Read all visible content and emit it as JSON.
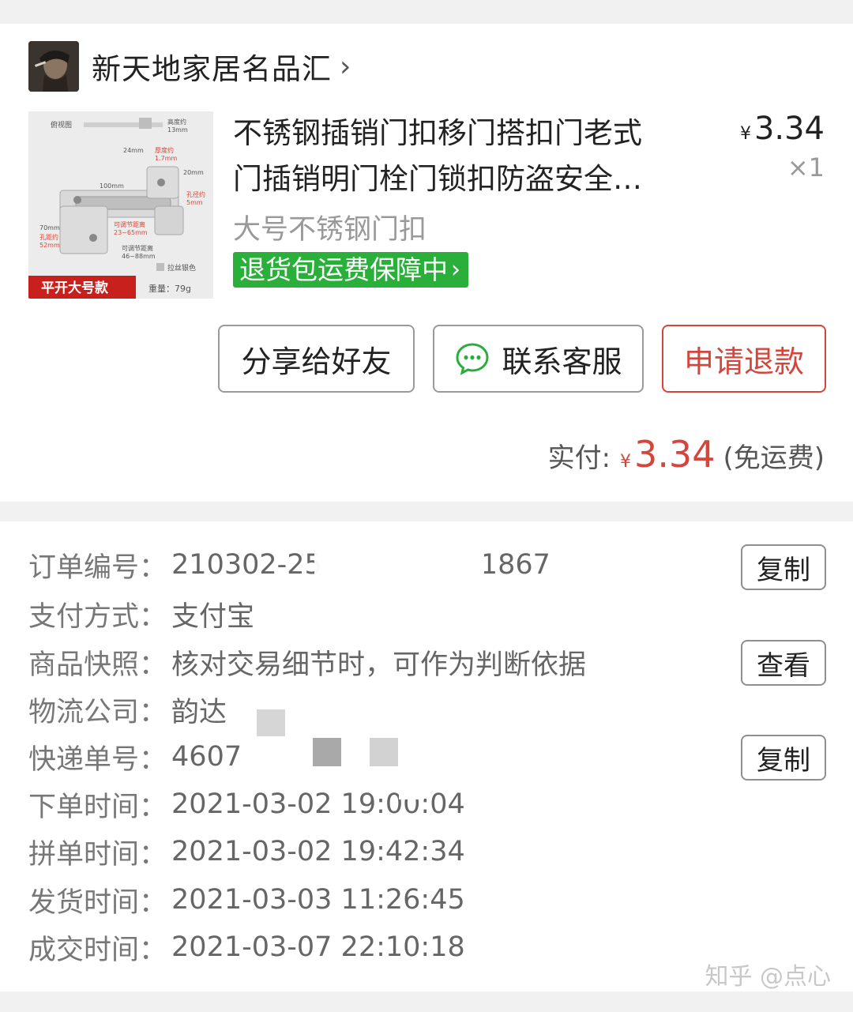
{
  "shop": {
    "name": "新天地家居名品汇",
    "chevron": "›"
  },
  "product": {
    "title_line1": "不锈钢插销门扣移门搭扣门老式",
    "title_line2": "门插销明门栓门锁扣防盗安全…",
    "currency": "¥",
    "price": "3.34",
    "quantity": "×1",
    "sku": "大号不锈钢门扣",
    "guarantee": "退货包运费保障中",
    "guarantee_chevron": "›",
    "image_labels": {
      "view": "俯视图",
      "height": "高度约",
      "height_val": "13mm",
      "thickness": "厚度约",
      "thickness_val": "1.7mm",
      "w24": "24mm",
      "w100": "100mm",
      "h20": "20mm",
      "hole": "孔径约",
      "hole_val": "5mm",
      "h70": "70mm",
      "hole2": "孔距约",
      "hole2_val": "52mm",
      "adj1": "可调节距离",
      "adj1_val": "23~65mm",
      "adj2": "可调节距离",
      "adj2_val": "46~88mm",
      "color": "拉丝银色",
      "badge": "平开大号款",
      "weight": "重量：79g"
    }
  },
  "actions": {
    "share": "分享给好友",
    "contact": "联系客服",
    "refund": "申请退款"
  },
  "payment": {
    "label": "实付:",
    "currency": "¥",
    "amount": "3.34",
    "note": "(免运费)"
  },
  "order_info": {
    "separator": "：",
    "rows": [
      {
        "label": "订单编号",
        "value": "210302-25",
        "value_tail": "1867"
      },
      {
        "label": "支付方式",
        "value": "支付宝"
      },
      {
        "label": "商品快照",
        "value": "核对交易细节时，可作为判断依据"
      },
      {
        "label": "物流公司",
        "value": "韵达"
      },
      {
        "label": "快递单号",
        "value": "4607"
      },
      {
        "label": "下单时间",
        "value": "2021-03-02 19:00:04"
      },
      {
        "label": "拼单时间",
        "value": "2021-03-02 19:42:34"
      },
      {
        "label": "发货时间",
        "value": "2021-03-03 11:26:45"
      },
      {
        "label": "成交时间",
        "value": "2021-03-07 22:10:18"
      }
    ],
    "copy_label": "复制",
    "view_label": "查看"
  },
  "watermark": "知乎 @点心",
  "colors": {
    "accent_red": "#d4453b",
    "guarantee_green": "#2ab03a",
    "wechat_green": "#2aae3b"
  }
}
